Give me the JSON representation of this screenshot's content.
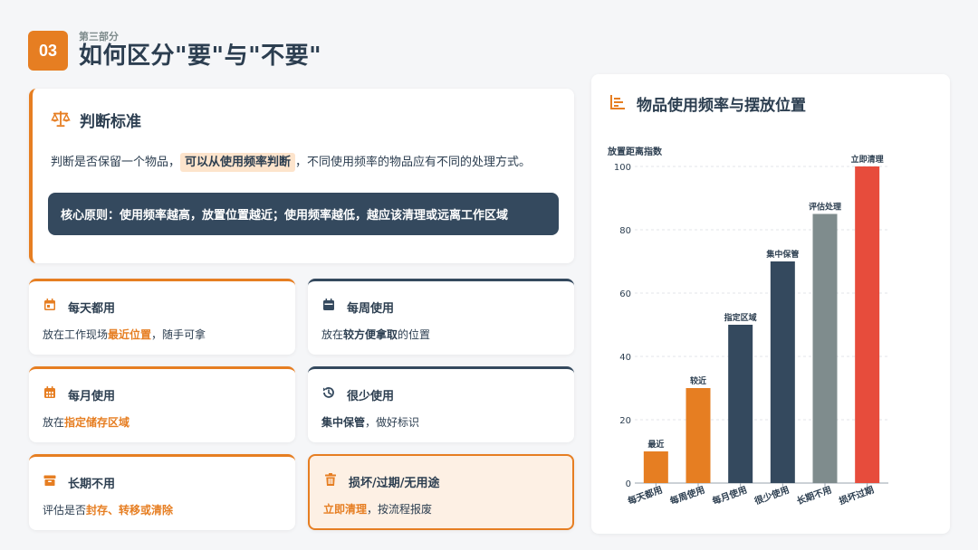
{
  "header": {
    "section_number": "03",
    "section_label": "第三部分",
    "title": "如何区分\"要\"与\"不要\""
  },
  "criteria": {
    "icon": "scale-icon",
    "title": "判断标准",
    "text_before": "判断是否保留一个物品，",
    "text_highlight": "可以从使用频率判断",
    "text_after": "，不同使用频率的物品应有不同的处理方式。",
    "principle": "核心原则：使用频率越高，放置位置越近；使用频率越低，越应该清理或远离工作区域"
  },
  "frequencies": [
    {
      "icon": "calendar-today-icon",
      "label": "每天都用",
      "desc_before": "放在工作现场",
      "desc_bold": "最近位置",
      "desc_after": "，随手可拿"
    },
    {
      "icon": "calendar-week-icon",
      "label": "每周使用",
      "desc_before": "放在",
      "desc_bold": "较方便拿取",
      "desc_after": "的位置"
    },
    {
      "icon": "calendar-month-icon",
      "label": "每月使用",
      "desc_before": "放在",
      "desc_bold": "指定储存区域",
      "desc_after": ""
    },
    {
      "icon": "history-icon",
      "label": "很少使用",
      "desc_before": "",
      "desc_bold": "集中保管",
      "desc_after": "，做好标识"
    },
    {
      "icon": "archive-box-icon",
      "label": "长期不用",
      "desc_before": "评估是否",
      "desc_bold": "封存、转移或清除",
      "desc_after": ""
    },
    {
      "icon": "trash-icon",
      "label": "损坏/过期/无用途",
      "desc_before": "",
      "desc_bold": "立即清理",
      "desc_after": "，按流程报废"
    }
  ],
  "chart_title": "物品使用频率与摆放位置",
  "chart_icon": "list-chart-icon",
  "colors": {
    "accent": "#e67e22",
    "dark": "#34495e",
    "gray": "#7f8c8d",
    "red": "#e74c3c"
  },
  "chart_data": {
    "type": "bar",
    "ylabel": "放置距离指数",
    "ylim": [
      0,
      100
    ],
    "yticks": [
      0,
      20,
      40,
      60,
      80,
      100
    ],
    "grid": true,
    "categories": [
      "每天都用",
      "每周使用",
      "每月使用",
      "很少使用",
      "长期不用",
      "损坏过期"
    ],
    "values": [
      10,
      30,
      50,
      70,
      85,
      100
    ],
    "data_labels": [
      "最近",
      "较近",
      "指定区域",
      "集中保管",
      "评估处理",
      "立即清理"
    ],
    "bar_colors": [
      "#e67e22",
      "#e67e22",
      "#34495e",
      "#34495e",
      "#7f8c8d",
      "#e74c3c"
    ]
  }
}
